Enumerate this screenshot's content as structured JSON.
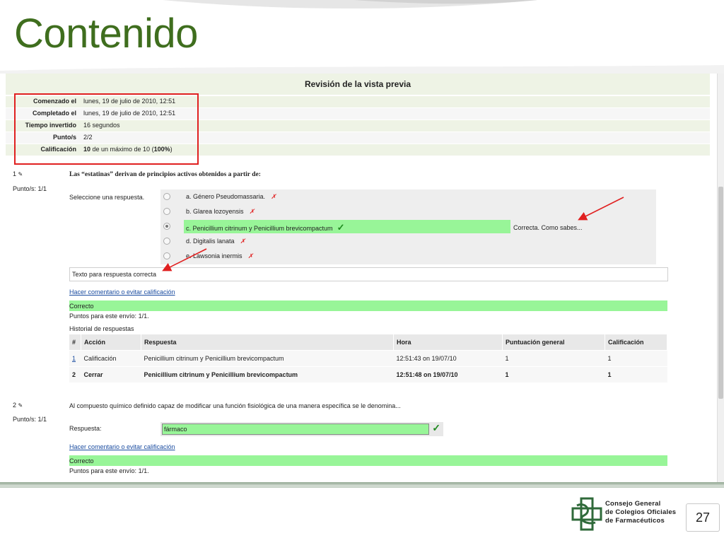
{
  "slide": {
    "title": "Contenido",
    "page_number": "27",
    "logo_text": [
      "Consejo General",
      "de Colegios Oficiales",
      "de Farmacéuticos"
    ]
  },
  "review": {
    "title": "Revisión de la vista previa",
    "summary": [
      {
        "label": "Comenzado el",
        "value": "lunes, 19 de julio de 2010, 12:51"
      },
      {
        "label": "Completado el",
        "value": "lunes, 19 de julio de 2010, 12:51"
      },
      {
        "label": "Tiempo invertido",
        "value": "16 segundos"
      },
      {
        "label": "Punto/s",
        "value": "2/2"
      },
      {
        "label": "Calificación",
        "value_bold": "10",
        "value": " de un máximo de 10 (",
        "value_pct": "100%",
        "value_end": ")"
      }
    ]
  },
  "q1": {
    "number": "1",
    "points": "Punto/s: 1/1",
    "text": "Las “estatinas” derivan de principios activos obtenidos a partir de:",
    "prompt": "Seleccione una respuesta.",
    "options": [
      {
        "label": "a. Género Pseudomassaria.",
        "mark": "✗"
      },
      {
        "label": "b. Glarea lozoyensis",
        "mark": "✗"
      },
      {
        "label": "c. Penicillium citrinum y Penicillium brevicompactum",
        "mark": "✓"
      },
      {
        "label": "d. Digitalis lanata",
        "mark": "✗"
      },
      {
        "label": "e. Lawsonia inermis",
        "mark": "✗"
      }
    ],
    "feedback": "Correcta. Como sabes...",
    "general_feedback": "Texto para respuesta correcta",
    "comment_link": "Hacer comentario o evitar calificación",
    "result": "Correcto",
    "points_sent": "Puntos para este envío: 1/1.",
    "history_title": "Historial de respuestas",
    "history": {
      "headers": [
        "#",
        "Acción",
        "Respuesta",
        "Hora",
        "Puntuación general",
        "Calificación"
      ],
      "rows": [
        [
          "1",
          "Calificación",
          "Penicillium citrinum y Penicillium brevicompactum",
          "12:51:43 on 19/07/10",
          "1",
          "1"
        ],
        [
          "2",
          "Cerrar",
          "Penicillium citrinum y Penicillium brevicompactum",
          "12:51:48 on 19/07/10",
          "1",
          "1"
        ]
      ]
    }
  },
  "q2": {
    "number": "2",
    "points": "Punto/s: 1/1",
    "text": "Al compuesto químico definido capaz de modificar una función fisiológica de una manera específica se le denomina...",
    "answer_label": "Respuesta:",
    "answer_value": "fármaco",
    "answer_mark": "✓",
    "comment_link": "Hacer comentario o evitar calificación",
    "result": "Correcto",
    "points_sent": "Puntos para este envío: 1/1."
  },
  "colors": {
    "title_green": "#3f6e1e",
    "correct_bg": "#98f598",
    "wrong_mark": "#e02020",
    "annotation_red": "#e02020",
    "link_blue": "#1a4ca0"
  }
}
